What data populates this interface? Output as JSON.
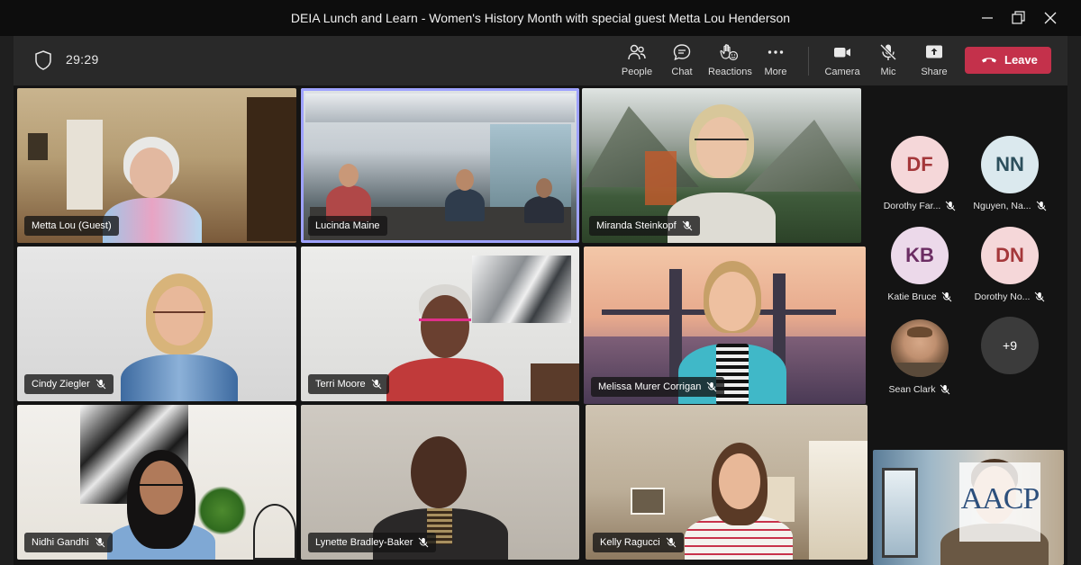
{
  "window": {
    "title": "DEIA Lunch and Learn - Women's History Month with special guest Metta Lou Henderson"
  },
  "toolbar": {
    "timer": "29:29",
    "people_label": "People",
    "chat_label": "Chat",
    "reactions_label": "Reactions",
    "more_label": "More",
    "camera_label": "Camera",
    "mic_label": "Mic",
    "share_label": "Share",
    "leave_label": "Leave"
  },
  "tiles": [
    {
      "name": "Metta Lou (Guest)",
      "muted": false
    },
    {
      "name": "Lucinda Maine",
      "muted": false
    },
    {
      "name": "Miranda Steinkopf",
      "muted": true
    },
    {
      "name": "Cindy Ziegler",
      "muted": true
    },
    {
      "name": "Terri Moore",
      "muted": true
    },
    {
      "name": "Melissa Murer Corrigan",
      "muted": true
    },
    {
      "name": "Nidhi Gandhi",
      "muted": true
    },
    {
      "name": "Lynette Bradley-Baker",
      "muted": true
    },
    {
      "name": "Kelly Ragucci",
      "muted": true
    }
  ],
  "roster": [
    {
      "initials": "DF",
      "name": "Dorothy Far...",
      "avatar_bg": "#f5d7d9",
      "avatar_fg": "#a4373a"
    },
    {
      "initials": "NN",
      "name": "Nguyen, Na...",
      "avatar_bg": "#dbe9ee",
      "avatar_fg": "#2c4f5c"
    },
    {
      "initials": "KB",
      "name": "Katie Bruce",
      "avatar_bg": "#ecd9ea",
      "avatar_fg": "#6b2d63"
    },
    {
      "initials": "DN",
      "name": "Dorothy No...",
      "avatar_bg": "#f5d7d9",
      "avatar_fg": "#a4373a"
    },
    {
      "initials": "",
      "name": "Sean Clark",
      "avatar_bg": "#8d6e55",
      "avatar_fg": "#ffffff"
    }
  ],
  "overflow_count": "+9",
  "logo_text": "AACP",
  "colors": {
    "accent": "#9ea2ff",
    "leave": "#c4314b"
  }
}
